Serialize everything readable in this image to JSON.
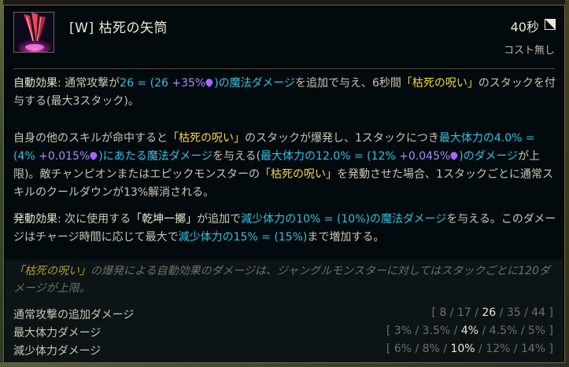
{
  "header": {
    "title": "[W] 枯死の矢筒",
    "cooldown": "40秒",
    "cost": "コスト無し"
  },
  "passive": {
    "label": "自動効果",
    "t1": ": 通常攻撃が",
    "dmg": "26 = (26",
    "ap": " +35%",
    "dmg_end": ")の魔法ダメージ",
    "t2": "を追加で与え、6秒間",
    "kw": "「枯死の呪い」",
    "t3": "のスタックを付与する(最大3スタック)。"
  },
  "stack": {
    "t1": "自身の他のスキルが命中すると",
    "kw1": "「枯死の呪い」",
    "t2": "のスタックが爆発し、1スタックにつき",
    "mhp": "最大体力の4.0% = (4%",
    "ap1": " +0.015%",
    "mhp_end": ")にあたる魔法ダメージ",
    "t3": "を与える(",
    "cap": "最大体力の12.0% = (12%",
    "ap2": " +0.045%",
    "cap_end": ")のダメージ",
    "t4": "が上限)。敵チャンピオンまたはエピックモンスターの",
    "kw2": "「枯死の呪い」",
    "t5": "を発動させた場合、1スタックごとに通常スキルのクールダウンが13%解消される。"
  },
  "active": {
    "label": "発動効果",
    "t1": ": 次に使用する",
    "kw": "「乾坤一擲」",
    "t2": "が追加で",
    "dmg": "減少体力の10% = (10%)の魔法ダメージ",
    "t3": "を与える。このダメージはチャージ時間に応じて最大で",
    "max": "減少体力の15% = (15%)",
    "t4": "まで増加する。"
  },
  "note": {
    "kw": "「枯死の呪い」",
    "text": "の爆発による自動効果のダメージは、ジャングルモンスターに対してはスタックごとに120ダメージが上限。"
  },
  "scaling": [
    {
      "name": "通常攻撃の追加ダメージ",
      "pre": "[ 8 / 17 / ",
      "cur": "26",
      "post": " / 35 / 44 ]"
    },
    {
      "name": "最大体力ダメージ",
      "pre": "[ 3% / 3.5% / ",
      "cur": "4%",
      "post": " / 4.5% / 5% ]"
    },
    {
      "name": "減少体力ダメージ",
      "pre": "[ 6% / 8% / ",
      "cur": "10%",
      "post": " / 12% / 14% ]"
    }
  ],
  "icons": {
    "ability": "blight-quiver-icon",
    "cooldown": "cooldown-icon",
    "ap": "ability-power-icon"
  },
  "colors": {
    "magic": "#35c0e0",
    "ap": "#a78bfa",
    "keyword": "#f2d64a",
    "border": "#6e6a52"
  }
}
